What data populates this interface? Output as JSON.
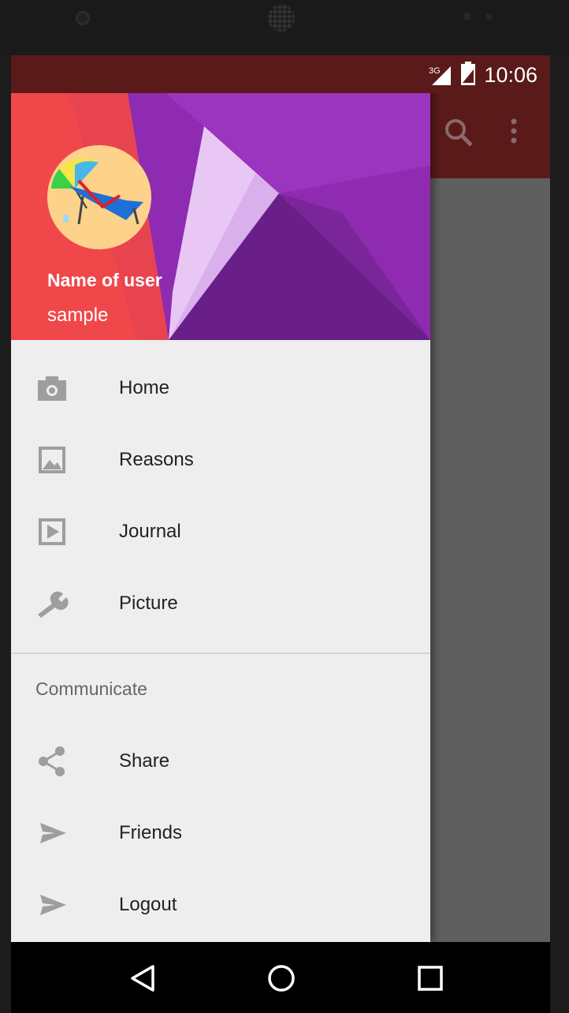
{
  "status_bar": {
    "time": "10:06",
    "network": "3G"
  },
  "drawer": {
    "user_name": "Name of user",
    "user_email": "sample",
    "items": [
      {
        "label": "Home",
        "icon": "camera-icon"
      },
      {
        "label": "Reasons",
        "icon": "image-icon"
      },
      {
        "label": "Journal",
        "icon": "play-icon"
      },
      {
        "label": "Picture",
        "icon": "wrench-icon"
      }
    ],
    "section_title": "Communicate",
    "section_items": [
      {
        "label": "Share",
        "icon": "share-icon"
      },
      {
        "label": "Friends",
        "icon": "send-icon"
      },
      {
        "label": "Logout",
        "icon": "send-icon"
      }
    ]
  },
  "colors": {
    "toolbar": "#5a1a1a",
    "drawer_bg": "#eeeeee",
    "icon_gray": "#9e9e9e"
  }
}
